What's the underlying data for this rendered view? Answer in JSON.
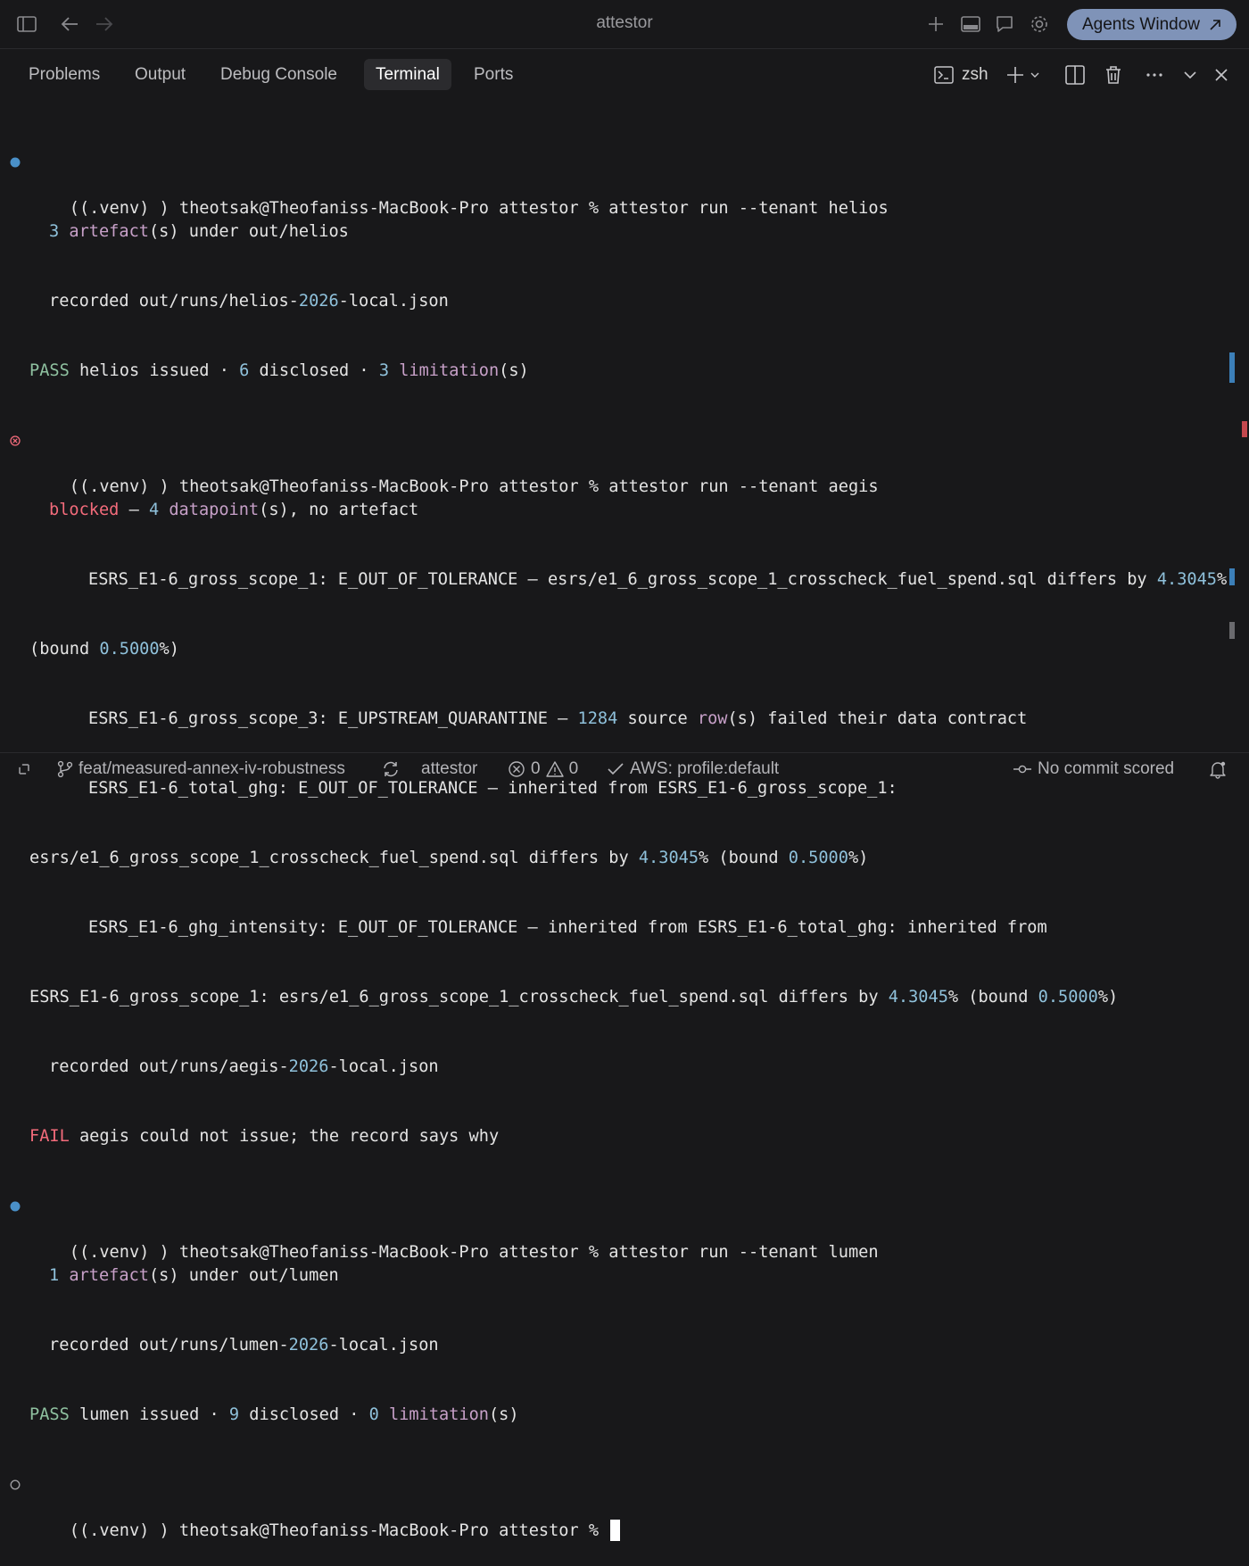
{
  "window": {
    "title": "attestor"
  },
  "titlebar": {
    "agents_button": "Agents Window"
  },
  "panel": {
    "tabs": [
      "Problems",
      "Output",
      "Debug Console",
      "Terminal",
      "Ports"
    ],
    "shell_label": "zsh"
  },
  "terminal": {
    "l1": {
      "prompt": "((.venv) ) theotsak@Theofaniss-MacBook-Pro attestor % ",
      "cmd": "attestor run --tenant helios"
    },
    "l2": {
      "n": "3",
      "kw": "artefact",
      "rest": "(s) under out/helios"
    },
    "l3": {
      "a": "recorded out/runs/helios-",
      "n": "2026",
      "b": "-local.json"
    },
    "l4": {
      "status": "PASS",
      "a": " helios issued · ",
      "n1": "6",
      "b": " disclosed · ",
      "n2": "3",
      "kw": " limitation",
      "c": "(s)"
    },
    "l5": {
      "prompt": "((.venv) ) theotsak@Theofaniss-MacBook-Pro attestor % ",
      "cmd": "attestor run --tenant aegis"
    },
    "l6": {
      "status": "blocked",
      "a": " — ",
      "n": "4",
      "kw": " datapoint",
      "b": "(s), no artefact"
    },
    "l7": {
      "a": "ESRS_E1-6_gross_scope_1: E_OUT_OF_TOLERANCE — esrs/e1_6_gross_scope_1_crosscheck_fuel_spend.sql differs by ",
      "n": "4.3045",
      "b": "%"
    },
    "l8": {
      "a": "(bound ",
      "n": "0.5000",
      "b": "%)"
    },
    "l9": {
      "a": "ESRS_E1-6_gross_scope_3: E_UPSTREAM_QUARANTINE — ",
      "n": "1284",
      "b": " source ",
      "kw": "row",
      "c": "(s) failed their data contract"
    },
    "l10": {
      "a": "ESRS_E1-6_total_ghg: E_OUT_OF_TOLERANCE — inherited from ESRS_E1-6_gross_scope_1:"
    },
    "l11": {
      "a": "esrs/e1_6_gross_scope_1_crosscheck_fuel_spend.sql differs by ",
      "n1": "4.3045",
      "b": "% (bound ",
      "n2": "0.5000",
      "c": "%)"
    },
    "l12": {
      "a": "ESRS_E1-6_ghg_intensity: E_OUT_OF_TOLERANCE — inherited from ESRS_E1-6_total_ghg: inherited from"
    },
    "l13": {
      "a": "ESRS_E1-6_gross_scope_1: esrs/e1_6_gross_scope_1_crosscheck_fuel_spend.sql differs by ",
      "n1": "4.3045",
      "b": "% (bound ",
      "n2": "0.5000",
      "c": "%)"
    },
    "l14": {
      "a": "recorded out/runs/aegis-",
      "n": "2026",
      "b": "-local.json"
    },
    "l15": {
      "status": "FAIL",
      "a": " aegis could not issue; the record says why"
    },
    "l16": {
      "prompt": "((.venv) ) theotsak@Theofaniss-MacBook-Pro attestor % ",
      "cmd": "attestor run --tenant lumen"
    },
    "l17": {
      "n": "1",
      "kw": " artefact",
      "rest": "(s) under out/lumen"
    },
    "l18": {
      "a": "recorded out/runs/lumen-",
      "n": "2026",
      "b": "-local.json"
    },
    "l19": {
      "status": "PASS",
      "a": " lumen issued · ",
      "n1": "9",
      "b": " disclosed · ",
      "n2": "0",
      "kw": " limitation",
      "c": "(s)"
    },
    "l20": {
      "prompt": "((.venv) ) theotsak@Theofaniss-MacBook-Pro attestor % "
    }
  },
  "statusbar": {
    "branch": "feat/measured-annex-iv-robustness",
    "workspace": "attestor",
    "errors": "0",
    "warnings": "0",
    "aws": "AWS: profile:default",
    "commit": "No commit scored"
  },
  "colors": {
    "accent": "#7f93b8",
    "number": "#8fc1db",
    "keyword": "#c7a0c8",
    "pass": "#8fc1a0",
    "fail": "#f36b7b",
    "success_dot": "#4a90c8"
  }
}
